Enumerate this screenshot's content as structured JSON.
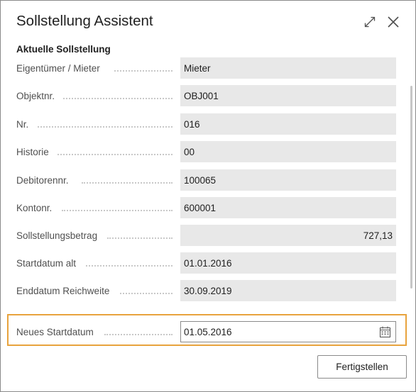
{
  "dialog": {
    "title": "Sollstellung Assistent"
  },
  "section": {
    "title": "Aktuelle Sollstellung"
  },
  "fields": [
    {
      "label": "Eigentümer / Mieter",
      "value": "Mieter"
    },
    {
      "label": "Objektnr.",
      "value": "OBJ001"
    },
    {
      "label": "Nr.",
      "value": "016"
    },
    {
      "label": "Historie",
      "value": "00"
    },
    {
      "label": "Debitorennr.",
      "value": "100065"
    },
    {
      "label": "Kontonr.",
      "value": "600001"
    },
    {
      "label": "Sollstellungsbetrag",
      "value": "727,13"
    },
    {
      "label": "Startdatum alt",
      "value": "01.01.2016"
    },
    {
      "label": "Enddatum Reichweite",
      "value": "30.09.2019"
    }
  ],
  "new_start": {
    "label": "Neues Startdatum",
    "value": "01.05.2016"
  },
  "actions": {
    "finish_label": "Fertigstellen"
  },
  "colors": {
    "highlight_border": "#e8a33d",
    "readonly_field_bg": "#e8e8e8"
  },
  "icons": {
    "expand": "expand-icon",
    "close": "close-icon",
    "calendar": "calendar-icon"
  }
}
